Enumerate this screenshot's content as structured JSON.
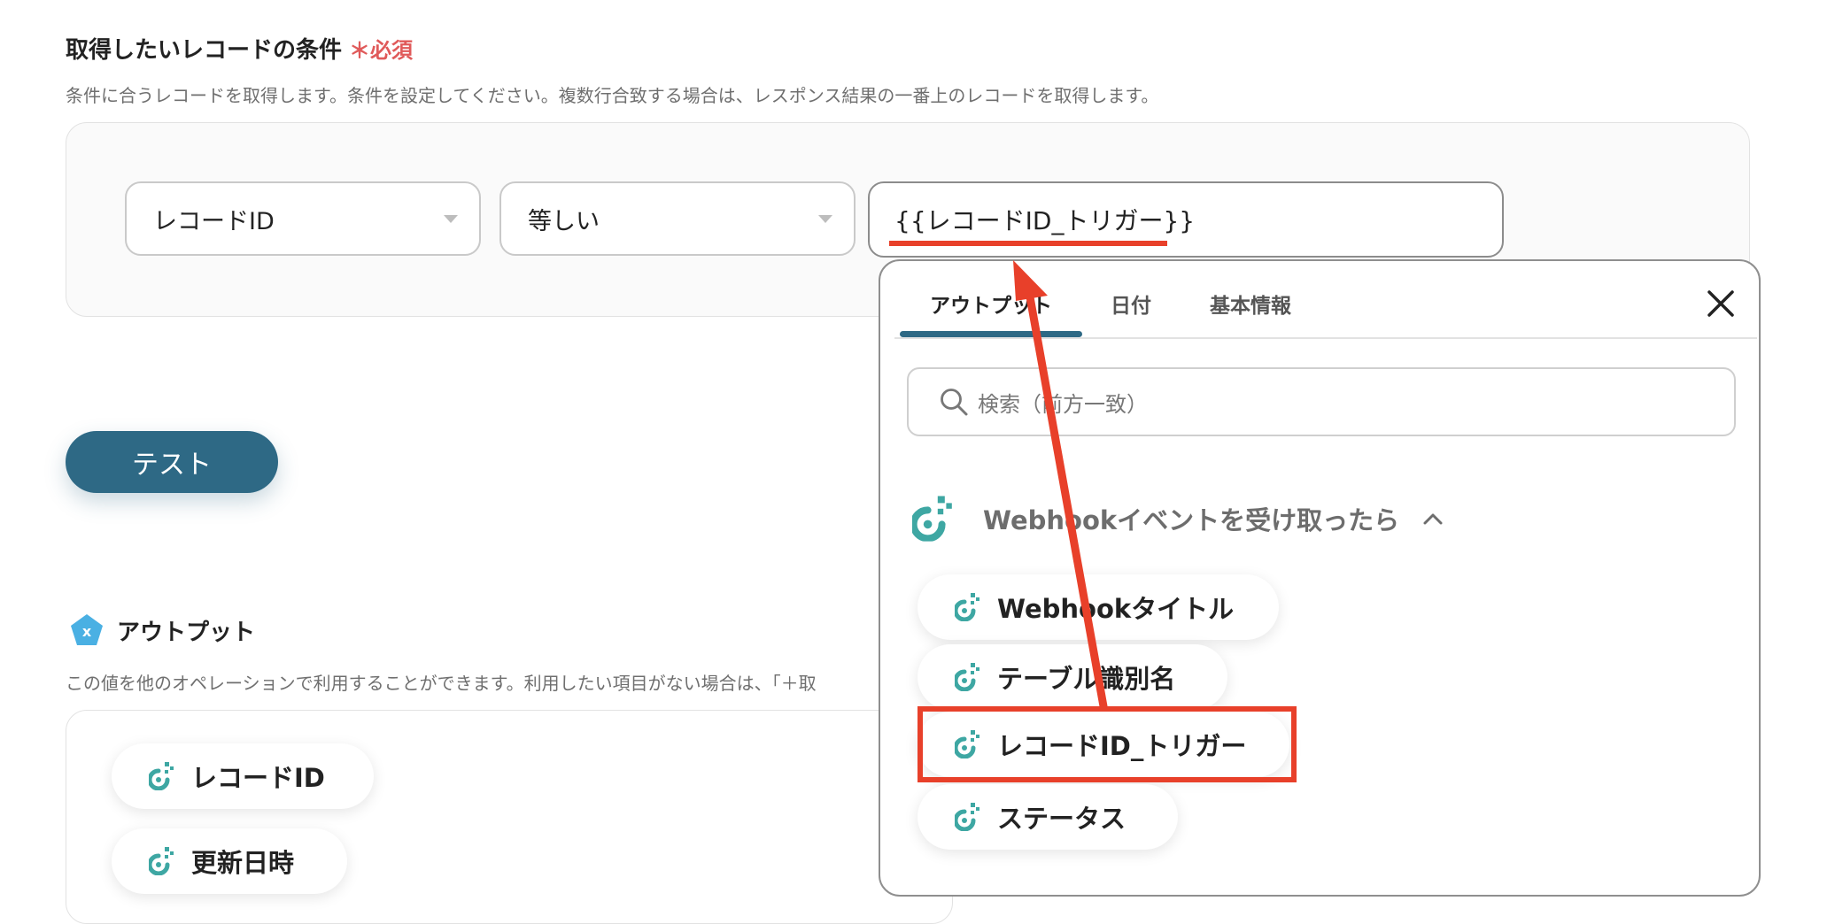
{
  "conditions": {
    "title": "取得したいレコードの条件",
    "required_label": "＊必須",
    "description": "条件に合うレコードを取得します。条件を設定してください。複数行合致する場合は、レスポンス結果の一番上のレコードを取得します。",
    "field_select": "レコードID",
    "operator_select": "等しい",
    "value_input": "{{レコードID_トリガー}}"
  },
  "test_button": "テスト",
  "output": {
    "title": "アウトプット",
    "description": "この値を他のオペレーションで利用することができます。利用したい項目がない場合は、「＋取",
    "items": [
      "レコードID",
      "更新日時"
    ]
  },
  "popup": {
    "tabs": [
      "アウトプット",
      "日付",
      "基本情報"
    ],
    "search_placeholder": "検索（前方一致）",
    "group_title": "Webhookイベントを受け取ったら",
    "items": [
      "Webhookタイトル",
      "テーブル識別名",
      "レコードID_トリガー",
      "ステータス"
    ]
  },
  "colors": {
    "accent": "#2e6985",
    "required": "#e05a5a",
    "annotation": "#e8402a",
    "yoom_icon": "#3ea7a3"
  }
}
